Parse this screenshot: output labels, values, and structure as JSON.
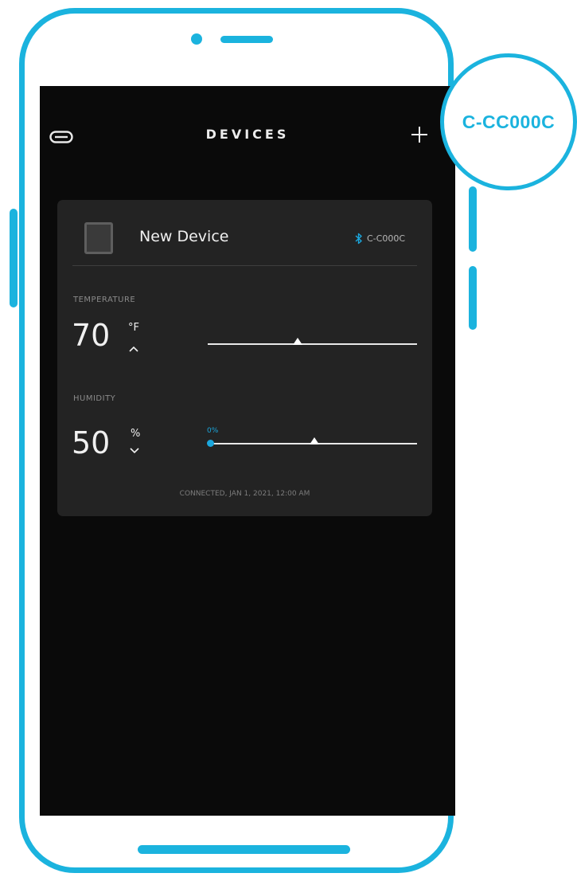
{
  "header": {
    "title": "DEVICES"
  },
  "device": {
    "name": "New Device",
    "bluetooth_id": "C-C000C"
  },
  "temperature": {
    "label": "TEMPERATURE",
    "value": "70",
    "unit": "°F",
    "slider_fraction": 0.43
  },
  "humidity": {
    "label": "HUMIDITY",
    "value": "50",
    "unit": "%",
    "min_label": "0%",
    "slider_fraction": 0.5
  },
  "status": "CONNECTED, JAN 1, 2021, 12:00 AM",
  "badge": {
    "text": "C-CC000C"
  },
  "colors": {
    "accent": "#1bb3de",
    "slider_accent": "#1ba7dd",
    "screen_bg": "#0a0a0a",
    "card_bg": "#232323"
  },
  "icons": {
    "menu": "menu-icon",
    "add": "plus-icon",
    "bluetooth": "bluetooth-icon",
    "device": "device-thumbnail-icon",
    "temp_toggle": "chevron-up-icon",
    "humidity_toggle": "chevron-down-icon"
  }
}
